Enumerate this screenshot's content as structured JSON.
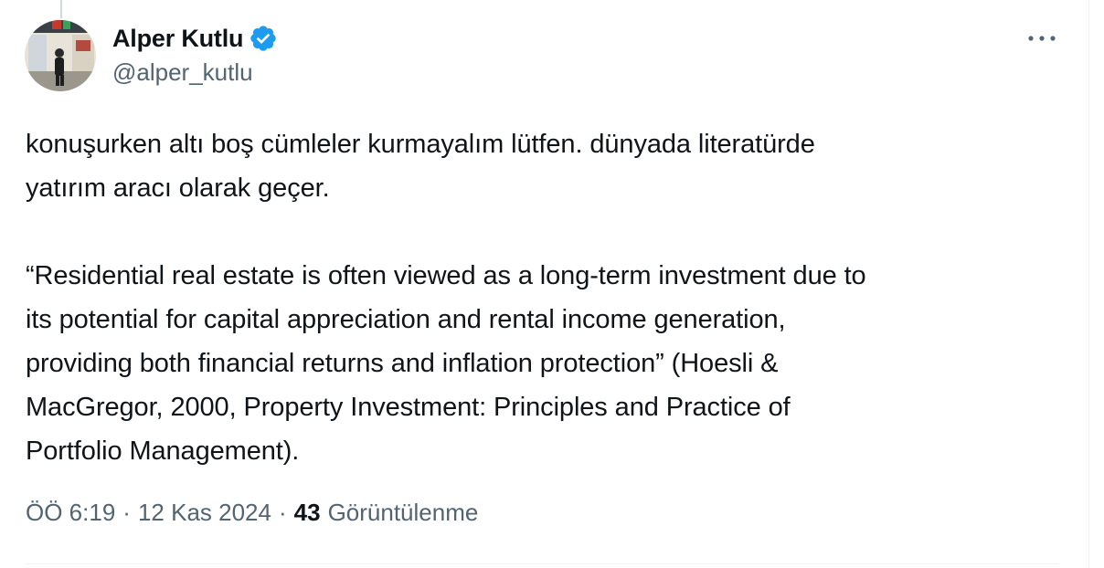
{
  "author": {
    "display_name": "Alper Kutlu",
    "handle": "@alper_kutlu",
    "verified": true
  },
  "tweet": {
    "text": "konuşurken altı boş cümleler kurmayalım lütfen. dünyada literatürde\nyatırım aracı olarak geçer.\n\n“Residential real estate is often viewed as a long-term investment due to\nits potential for capital appreciation and rental income generation,\nproviding both financial returns and inflation protection” (Hoesli &\nMacGregor, 2000, Property Investment: Principles and Practice of\nPortfolio Management).",
    "time": "ÖÖ 6:19",
    "separator": "·",
    "date": "12 Kas 2024",
    "views_count": "43",
    "views_label": "Görüntülenme"
  },
  "icons": {
    "verified": "verified-badge-icon",
    "more": "more-horizontal-icon"
  },
  "colors": {
    "text_primary": "#0f1419",
    "text_secondary": "#536471",
    "verified_blue": "#1d9bf0",
    "divider": "#eff3f4"
  }
}
